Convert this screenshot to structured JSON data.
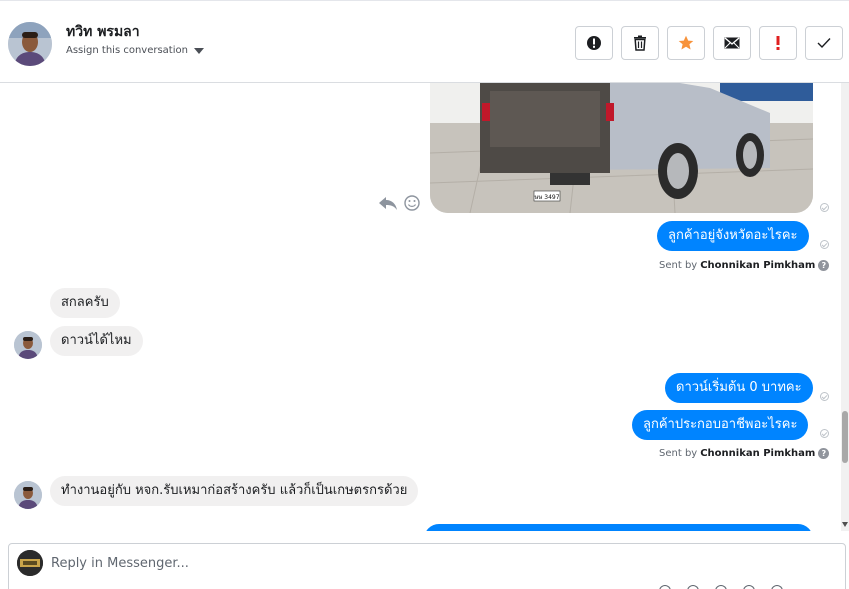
{
  "header": {
    "contact_name": "ทวิท พรมลา",
    "assign_label": "Assign this conversation"
  },
  "actions": [
    {
      "name": "mark-spam-button",
      "icon": "exclamation-circle-icon"
    },
    {
      "name": "delete-button",
      "icon": "trash-icon"
    },
    {
      "name": "star-button",
      "icon": "star-icon",
      "color": "#f7923a"
    },
    {
      "name": "mark-unread-button",
      "icon": "envelope-icon"
    },
    {
      "name": "follow-up-button",
      "icon": "exclamation-icon",
      "color": "#e02020"
    },
    {
      "name": "mark-done-button",
      "icon": "check-icon"
    }
  ],
  "thread": {
    "messages": [
      {
        "id": "m1",
        "from": "page",
        "text": "ลูกค้าอยู่จังหวัดอะไรคะ"
      },
      {
        "id": "m2",
        "from": "customer",
        "text": "สกลครับ"
      },
      {
        "id": "m3",
        "from": "customer",
        "text": "ดาวน์ได้ไหม"
      },
      {
        "id": "m4",
        "from": "page",
        "text": "ดาวน์เริ่มต้น 0 บาทคะ"
      },
      {
        "id": "m5",
        "from": "page",
        "text": "ลูกค้าประกอบอาชีพอะไรคะ"
      },
      {
        "id": "m6",
        "from": "customer",
        "text": "ทำงานอยู่กับ หจก.รับเหมาก่อสร้างครับ แล้วก็เป็นเกษตรกรด้วย"
      }
    ],
    "sent_by_prefix": "Sent by",
    "sender_name": "Chonnikan Pimkham",
    "photo_plate": "ษษ 3497"
  },
  "composer": {
    "placeholder": "Reply in Messenger..."
  },
  "colors": {
    "outgoing_bubble": "#0084ff",
    "incoming_bubble": "#f1f0f0"
  }
}
